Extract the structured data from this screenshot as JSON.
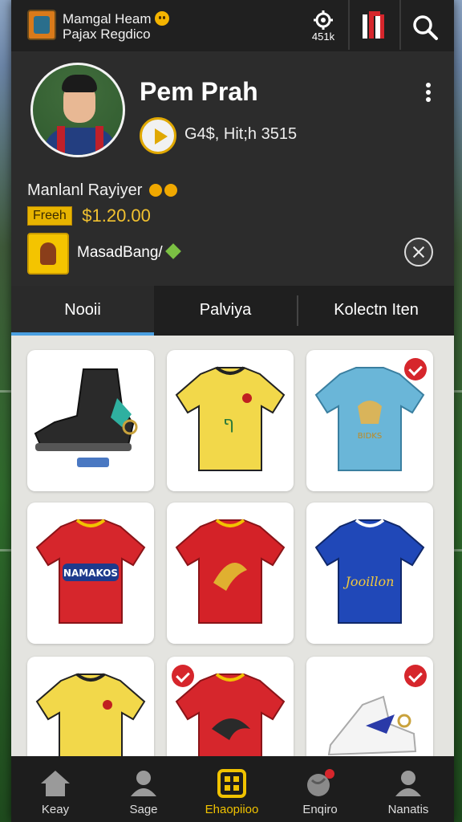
{
  "header": {
    "brand_line1": "Mamgal Heam",
    "brand_line2": "Pajax Regdico",
    "settings_count": "451k"
  },
  "profile": {
    "name": "Pem Prah",
    "play_text": "G4$, Hit;h 3515",
    "subtitle": "Manlanl Rayiyer",
    "price_badge": "Freeh",
    "price": "$1.20.00",
    "team_label": "MasadBang/"
  },
  "tabs": [
    {
      "label": "Nooii",
      "active": true
    },
    {
      "label": "Palviya",
      "active": false
    },
    {
      "label": "Kolectn Iten",
      "active": false
    }
  ],
  "products": [
    {
      "kind": "boot",
      "checked": false
    },
    {
      "kind": "yellow-jersey",
      "checked": false
    },
    {
      "kind": "lightblue-jersey",
      "checked": true,
      "text": "BIDKS"
    },
    {
      "kind": "red-jersey",
      "checked": false,
      "text": "NAMAKOS"
    },
    {
      "kind": "red-jersey-2",
      "checked": false
    },
    {
      "kind": "blue-jersey",
      "checked": false,
      "text": "Jooillon"
    },
    {
      "kind": "yellow-jersey-2",
      "checked": false
    },
    {
      "kind": "red-jersey-3",
      "checked": true
    },
    {
      "kind": "white-sneaker",
      "checked": true
    }
  ],
  "nav": [
    {
      "label": "Keay",
      "icon": "home-icon",
      "active": false
    },
    {
      "label": "Sage",
      "icon": "user-icon",
      "active": false
    },
    {
      "label": "Ehaopiioo",
      "icon": "grid-icon",
      "active": true
    },
    {
      "label": "Enqiro",
      "icon": "globe-icon",
      "active": false
    },
    {
      "label": "Nanatis",
      "icon": "person-icon",
      "active": false
    }
  ],
  "colors": {
    "accent": "#f0c200",
    "tab_indicator": "#4a9fe0",
    "check": "#d6262c"
  }
}
